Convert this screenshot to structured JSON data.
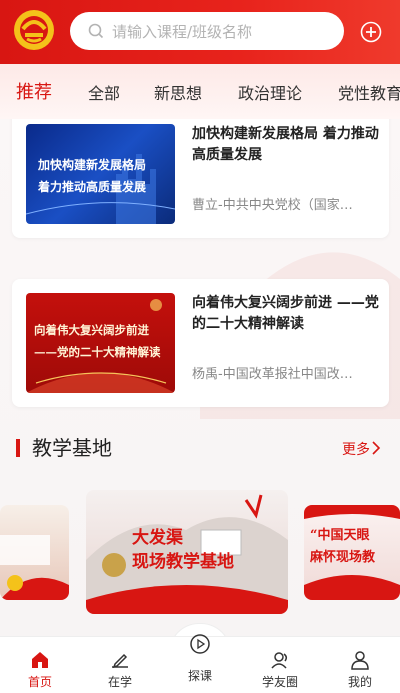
{
  "header": {
    "logo_icon": "party-emblem-icon",
    "search_placeholder": "请输入课程/班级名称",
    "add_icon": "plus-circle-icon",
    "accent": "#d81612"
  },
  "tabs": [
    {
      "label": "推荐",
      "active": true
    },
    {
      "label": "全部",
      "active": false
    },
    {
      "label": "新思想",
      "active": false
    },
    {
      "label": "政治理论",
      "active": false
    },
    {
      "label": "党性教育",
      "active": false
    }
  ],
  "courses": [
    {
      "title": "加快构建新发展格局 着力推动高质量发展",
      "source": "曹立-中共中央党校（国家…",
      "thumb_lines": [
        "加快构建新发展格局",
        "着力推动高质量发展"
      ]
    },
    {
      "title": "向着伟大复兴阔步前进 ——党的二十大精神解读",
      "source": "杨禹-中国改革报社中国改…",
      "thumb_lines": [
        "向着伟大复兴阔步前进",
        "——党的二十大精神解读"
      ]
    }
  ],
  "teaching_base": {
    "title": "教学基地",
    "more": "更多",
    "cards": [
      {
        "text": ""
      },
      {
        "text_line1": "大发渠",
        "text_line2": "现场教学基地"
      },
      {
        "text_line1": "“中国天眼",
        "text_line2": "麻怀现场教"
      }
    ]
  },
  "bottom_nav": [
    {
      "label": "首页",
      "icon": "home-icon",
      "active": true
    },
    {
      "label": "在学",
      "icon": "pen-book-icon",
      "active": false
    },
    {
      "label": "探课",
      "icon": "play-circle-icon",
      "active": false
    },
    {
      "label": "学友圈",
      "icon": "friends-icon",
      "active": false
    },
    {
      "label": "我的",
      "icon": "user-icon",
      "active": false
    }
  ]
}
